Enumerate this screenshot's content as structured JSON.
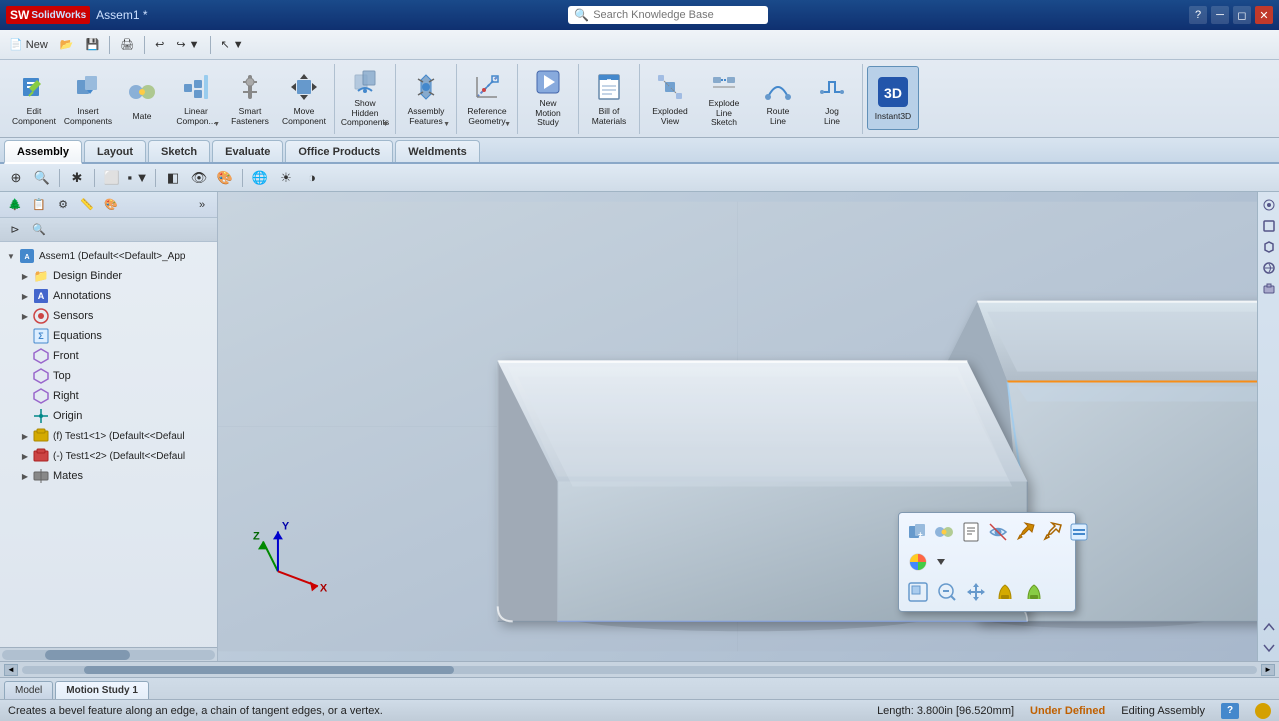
{
  "app": {
    "name": "SolidWorks",
    "logo_text": "SW",
    "title": "Assem1 *",
    "version": "SolidWorks"
  },
  "search": {
    "placeholder": "Search Knowledge Base"
  },
  "titlebar": {
    "buttons": [
      "minimize",
      "restore",
      "close"
    ]
  },
  "toolbar_row1": {
    "items": [
      {
        "label": "New",
        "icon": "📄"
      },
      {
        "label": "Open",
        "icon": "📂"
      },
      {
        "label": "Save",
        "icon": "💾"
      },
      {
        "label": "Print",
        "icon": "🖨"
      },
      {
        "label": "Undo",
        "icon": "↩"
      },
      {
        "label": "Redo",
        "icon": "↪"
      },
      {
        "label": "Select",
        "icon": "↖"
      }
    ]
  },
  "toolbar_main": {
    "groups": [
      {
        "id": "edit",
        "buttons": [
          {
            "id": "edit-component",
            "label": "Edit\nComponent",
            "icon": "✏️"
          },
          {
            "id": "insert-components",
            "label": "Insert\nComponents",
            "icon": "📥"
          },
          {
            "id": "mate",
            "label": "Mate",
            "icon": "🔗"
          },
          {
            "id": "linear-component",
            "label": "Linear\nCompon...",
            "icon": "⊞"
          },
          {
            "id": "smart-fasteners",
            "label": "Smart\nFasteners",
            "icon": "🔩"
          },
          {
            "id": "move-component",
            "label": "Move\nComponent",
            "icon": "↕"
          }
        ]
      },
      {
        "id": "show-hide",
        "buttons": [
          {
            "id": "show-hidden",
            "label": "Show\nHidden\nComponents",
            "icon": "👁"
          }
        ]
      },
      {
        "id": "assembly-features",
        "buttons": [
          {
            "id": "assembly-features",
            "label": "Assembly\nFeatures",
            "icon": "⚙"
          }
        ]
      },
      {
        "id": "reference",
        "buttons": [
          {
            "id": "reference-geometry",
            "label": "Reference\nGeometry",
            "icon": "📐"
          }
        ]
      },
      {
        "id": "motion",
        "buttons": [
          {
            "id": "new-motion-study",
            "label": "New\nMotion Study",
            "icon": "▶"
          }
        ]
      },
      {
        "id": "bom",
        "buttons": [
          {
            "id": "bill-of-materials",
            "label": "Bill of\nMaterials",
            "icon": "📋"
          }
        ]
      },
      {
        "id": "explode",
        "buttons": [
          {
            "id": "exploded-view",
            "label": "Exploded\nView",
            "icon": "💥"
          },
          {
            "id": "explode-line-sketch",
            "label": "Explode\nLine\nSketch",
            "icon": "📏"
          },
          {
            "id": "route-line",
            "label": "Route\nLine",
            "icon": "〰"
          },
          {
            "id": "jog-line",
            "label": "Jog\nLine",
            "icon": "Ζ"
          }
        ]
      },
      {
        "id": "instant3d",
        "buttons": [
          {
            "id": "instant3d",
            "label": "Instant3D",
            "icon": "3D",
            "active": true
          }
        ]
      }
    ]
  },
  "tabs": [
    {
      "id": "assembly",
      "label": "Assembly",
      "active": true
    },
    {
      "id": "layout",
      "label": "Layout"
    },
    {
      "id": "sketch",
      "label": "Sketch"
    },
    {
      "id": "evaluate",
      "label": "Evaluate"
    },
    {
      "id": "office-products",
      "label": "Office Products"
    },
    {
      "id": "weldments",
      "label": "Weldments"
    }
  ],
  "view_toolbar": {
    "buttons": [
      {
        "id": "zoom-to-fit",
        "icon": "⊕",
        "title": "Zoom to Fit"
      },
      {
        "id": "zoom-in",
        "icon": "🔍",
        "title": "Zoom In"
      },
      {
        "id": "select-filter",
        "icon": "✱",
        "title": "Select Filter"
      },
      {
        "id": "view-orientation",
        "icon": "⬜",
        "title": "View Orientation"
      },
      {
        "id": "display-style",
        "icon": "▪",
        "title": "Display Style"
      },
      {
        "id": "section-view",
        "icon": "◧",
        "title": "Section View"
      },
      {
        "id": "hide-show",
        "icon": "👁",
        "title": "Hide/Show"
      },
      {
        "id": "appearance",
        "icon": "🎨",
        "title": "Appearance"
      },
      {
        "id": "scene",
        "icon": "🌐",
        "title": "Scene"
      },
      {
        "id": "realview",
        "icon": "☀",
        "title": "RealView"
      },
      {
        "id": "shadows",
        "icon": "◑",
        "title": "Shadows"
      }
    ]
  },
  "left_panel": {
    "toolbar_buttons": [
      {
        "id": "feature-manager",
        "icon": "🌲",
        "title": "FeatureManager"
      },
      {
        "id": "property-manager",
        "icon": "📋",
        "title": "PropertyManager"
      },
      {
        "id": "configuration-manager",
        "icon": "⚙",
        "title": "ConfigurationManager"
      },
      {
        "id": "dim-expert",
        "icon": "📏",
        "title": "DimXpert"
      },
      {
        "id": "display-manager",
        "icon": "🎨",
        "title": "DisplayManager"
      }
    ],
    "expand_btn": "»"
  },
  "feature_tree": {
    "root_label": "Assem1 (Default<<Default>_App",
    "items": [
      {
        "id": "design-binder",
        "label": "Design Binder",
        "icon": "📁",
        "indent": 1,
        "expand": false
      },
      {
        "id": "annotations",
        "label": "Annotations",
        "icon": "A",
        "indent": 1,
        "expand": true,
        "icon_color": "blue"
      },
      {
        "id": "sensors",
        "label": "Sensors",
        "icon": "◉",
        "indent": 1,
        "expand": false,
        "icon_color": "red"
      },
      {
        "id": "equations",
        "label": "Equations",
        "icon": "Σ",
        "indent": 1,
        "expand": false,
        "icon_color": "blue"
      },
      {
        "id": "front",
        "label": "Front",
        "indent": 1,
        "icon": "◇",
        "icon_color": "purple"
      },
      {
        "id": "top",
        "label": "Top",
        "indent": 1,
        "icon": "◇",
        "icon_color": "purple"
      },
      {
        "id": "right",
        "label": "Right",
        "indent": 1,
        "icon": "◇",
        "icon_color": "purple"
      },
      {
        "id": "origin",
        "label": "Origin",
        "indent": 1,
        "icon": "✛",
        "icon_color": "teal"
      },
      {
        "id": "test1-1",
        "label": "(f) Test1<1> (Default<<Defaul",
        "indent": 1,
        "icon": "⬡",
        "icon_color": "yellow"
      },
      {
        "id": "test1-2",
        "label": "(-) Test1<2> (Default<<Defaul",
        "indent": 1,
        "icon": "⬡",
        "icon_color": "red"
      },
      {
        "id": "mates",
        "label": "Mates",
        "indent": 1,
        "icon": "◈",
        "icon_color": "gray"
      }
    ]
  },
  "context_popup": {
    "rows": [
      [
        {
          "id": "add-component",
          "icon": "➕",
          "title": "Add Component"
        },
        {
          "id": "mate",
          "icon": "🔗",
          "title": "Mate"
        },
        {
          "id": "properties",
          "icon": "📋",
          "title": "Properties"
        },
        {
          "id": "hide",
          "icon": "👁",
          "title": "Hide"
        },
        {
          "id": "fix",
          "icon": "📌",
          "title": "Fix"
        },
        {
          "id": "float",
          "icon": "◎",
          "title": "Float"
        },
        {
          "id": "more",
          "icon": "⋯",
          "title": "More"
        }
      ],
      [
        {
          "id": "colorize",
          "icon": "🎨",
          "title": "Colorize"
        },
        {
          "id": "color-dropdown",
          "icon": "▼",
          "title": "Color options"
        }
      ],
      [
        {
          "id": "zoom-component",
          "icon": "⊡",
          "title": "Zoom Component"
        },
        {
          "id": "zoom-out",
          "icon": "🔍",
          "title": "Zoom Out"
        },
        {
          "id": "move",
          "icon": "↕",
          "title": "Move"
        },
        {
          "id": "appearance2",
          "icon": "⬡",
          "title": "Appearance"
        },
        {
          "id": "component-appearance",
          "icon": "⬡",
          "title": "Component Appearance"
        }
      ]
    ]
  },
  "axis_indicator": {
    "x_color": "#cc0000",
    "y_color": "#0000cc",
    "z_color": "#008800",
    "x_label": "X",
    "y_label": "Y",
    "z_label": "Z"
  },
  "status_bar": {
    "message": "Creates a bevel feature along an edge, a chain of tangent edges, or a vertex.",
    "length": "Length: 3.800in [96.520mm]",
    "status": "Under Defined",
    "mode": "Editing Assembly",
    "help_icon": "?",
    "indicator_color": "#d4a000"
  },
  "bottom_tabs": [
    {
      "id": "model",
      "label": "Model",
      "active": false
    },
    {
      "id": "motion-study-1",
      "label": "Motion Study 1",
      "active": true
    }
  ]
}
